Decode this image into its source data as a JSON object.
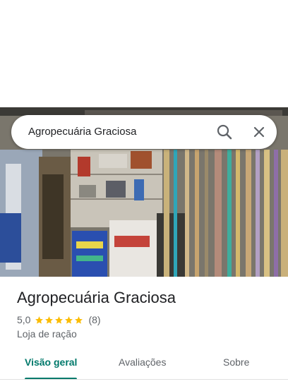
{
  "search": {
    "query": "Agropecuária Graciosa"
  },
  "place": {
    "name": "Agropecuária Graciosa",
    "rating": "5,0",
    "stars": 5,
    "review_count": "(8)",
    "category": "Loja de ração"
  },
  "tabs": [
    {
      "label": "Visão geral",
      "active": true
    },
    {
      "label": "Avaliações",
      "active": false
    },
    {
      "label": "Sobre",
      "active": false
    }
  ],
  "colors": {
    "accent": "#00796b",
    "star": "#fbbc04",
    "text": "#202124",
    "secondary": "#5f6368"
  },
  "icons": {
    "search": "search-icon",
    "close": "close-icon",
    "star": "star-icon"
  }
}
